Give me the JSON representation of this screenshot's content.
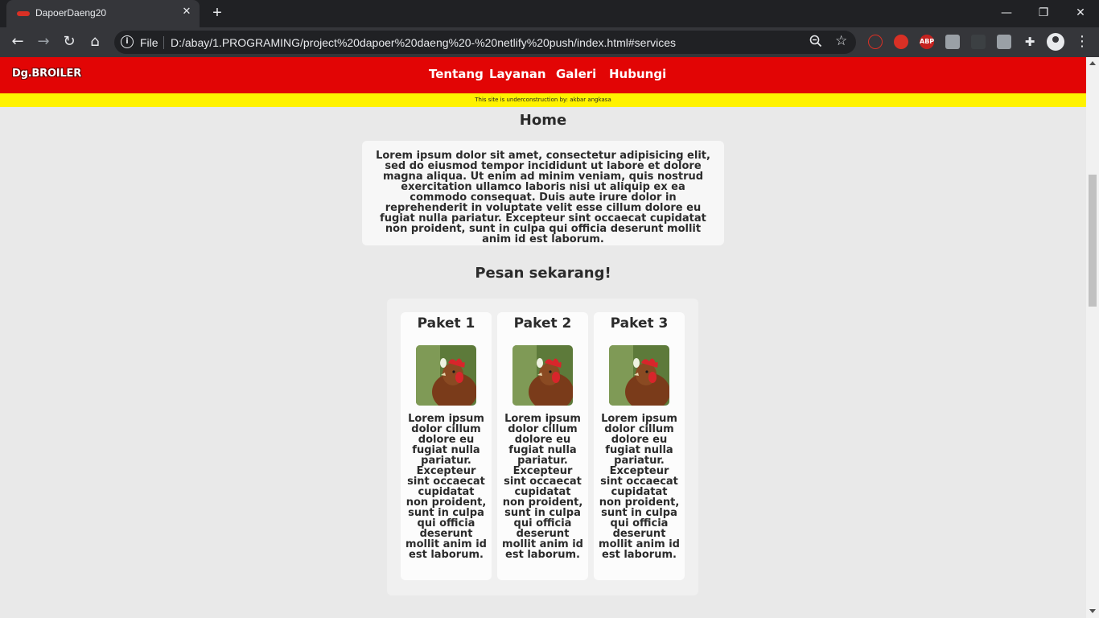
{
  "browser": {
    "tab_title": "DapoerDaeng20",
    "scheme_label": "File",
    "url": "D:/abay/1.PROGRAMING/project%20dapoer%20daeng%20-%20netlify%20push/index.html#services",
    "extensions": [
      "abp-icon"
    ],
    "extension_abp_label": "ABP"
  },
  "site": {
    "logo": "Dg.BROILER",
    "nav": [
      "Tentang",
      "Layanan",
      "Galeri",
      "Hubungi"
    ],
    "notice": "This site is underconstruction by: akbar angkasa",
    "brand_colors": {
      "navbar": "#e20505",
      "notice": "#fff200",
      "page_bg": "#e9e9e9"
    }
  },
  "home": {
    "heading": "Home",
    "text": "Lorem ipsum dolor sit amet, consectetur adipisicing elit, sed do eiusmod tempor incididunt ut labore et dolore magna aliqua. Ut enim ad minim veniam, quis nostrud exercitation ullamco laboris nisi ut aliquip ex ea commodo consequat. Duis aute irure dolor in reprehenderit in voluptate velit esse cillum dolore eu fugiat nulla pariatur. Excepteur sint occaecat cupidatat non proident, sunt in culpa qui officia deserunt mollit anim id est laborum."
  },
  "order": {
    "heading": "Pesan sekarang!",
    "packages": [
      {
        "title": "Paket 1",
        "desc": "Lorem ipsum dolor cillum dolore eu fugiat nulla pariatur. Excepteur sint occaecat cupidatat non proident, sunt in culpa qui officia deserunt mollit anim id est laborum."
      },
      {
        "title": "Paket 2",
        "desc": "Lorem ipsum dolor cillum dolore eu fugiat nulla pariatur. Excepteur sint occaecat cupidatat non proident, sunt in culpa qui officia deserunt mollit anim id est laborum."
      },
      {
        "title": "Paket 3",
        "desc": "Lorem ipsum dolor cillum dolore eu fugiat nulla pariatur. Excepteur sint occaecat cupidatat non proident, sunt in culpa qui officia deserunt mollit anim id est laborum."
      }
    ]
  }
}
